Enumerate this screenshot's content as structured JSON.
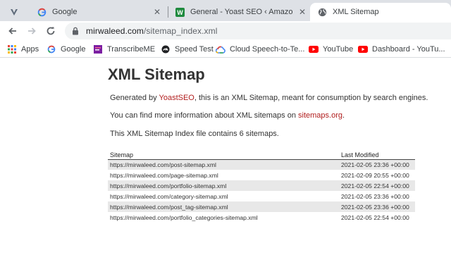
{
  "browser": {
    "tabs": [
      {
        "title": "Google",
        "favicon": "google-g-icon",
        "active": false
      },
      {
        "title": "General - Yoast SEO ‹ Amazon FB",
        "favicon": "wordpress-w-icon",
        "active": false
      },
      {
        "title": "XML Sitemap",
        "favicon": "globe-icon",
        "active": true
      }
    ],
    "address": {
      "domain": "mirwaleed.com",
      "path": "/sitemap_index.xml"
    },
    "bookmarks": [
      {
        "label": "Apps",
        "icon": "apps-grid-icon"
      },
      {
        "label": "Google",
        "icon": "google-g-icon"
      },
      {
        "label": "TranscribeME",
        "icon": "transcribeme-icon"
      },
      {
        "label": "Speed Test",
        "icon": "speedtest-icon"
      },
      {
        "label": "Cloud Speech-to-Te...",
        "icon": "google-cloud-icon"
      },
      {
        "label": "YouTube",
        "icon": "youtube-icon"
      },
      {
        "label": "Dashboard - YouTu...",
        "icon": "youtube-icon"
      }
    ]
  },
  "page": {
    "heading": "XML Sitemap",
    "intro": {
      "prefix": "Generated by ",
      "link": "YoastSEO",
      "suffix": ", this is an XML Sitemap, meant for consumption by search engines."
    },
    "more_info": {
      "prefix": "You can find more information about XML sitemaps on ",
      "link": "sitemaps.org",
      "suffix": "."
    },
    "summary": "This XML Sitemap Index file contains 6 sitemaps.",
    "table": {
      "headers": {
        "sitemap": "Sitemap",
        "modified": "Last Modified"
      },
      "rows": [
        {
          "url": "https://mirwaleed.com/post-sitemap.xml",
          "modified": "2021-02-05 23:36 +00:00"
        },
        {
          "url": "https://mirwaleed.com/page-sitemap.xml",
          "modified": "2021-02-09 20:55 +00:00"
        },
        {
          "url": "https://mirwaleed.com/portfolio-sitemap.xml",
          "modified": "2021-02-05 22:54 +00:00"
        },
        {
          "url": "https://mirwaleed.com/category-sitemap.xml",
          "modified": "2021-02-05 23:36 +00:00"
        },
        {
          "url": "https://mirwaleed.com/post_tag-sitemap.xml",
          "modified": "2021-02-05 23:36 +00:00"
        },
        {
          "url": "https://mirwaleed.com/portfolio_categories-sitemap.xml",
          "modified": "2021-02-05 22:54 +00:00"
        }
      ]
    }
  },
  "colors": {
    "link": "#b11d1d",
    "tabstrip": "#dee1e6",
    "row_alt": "#e8e8e8"
  }
}
